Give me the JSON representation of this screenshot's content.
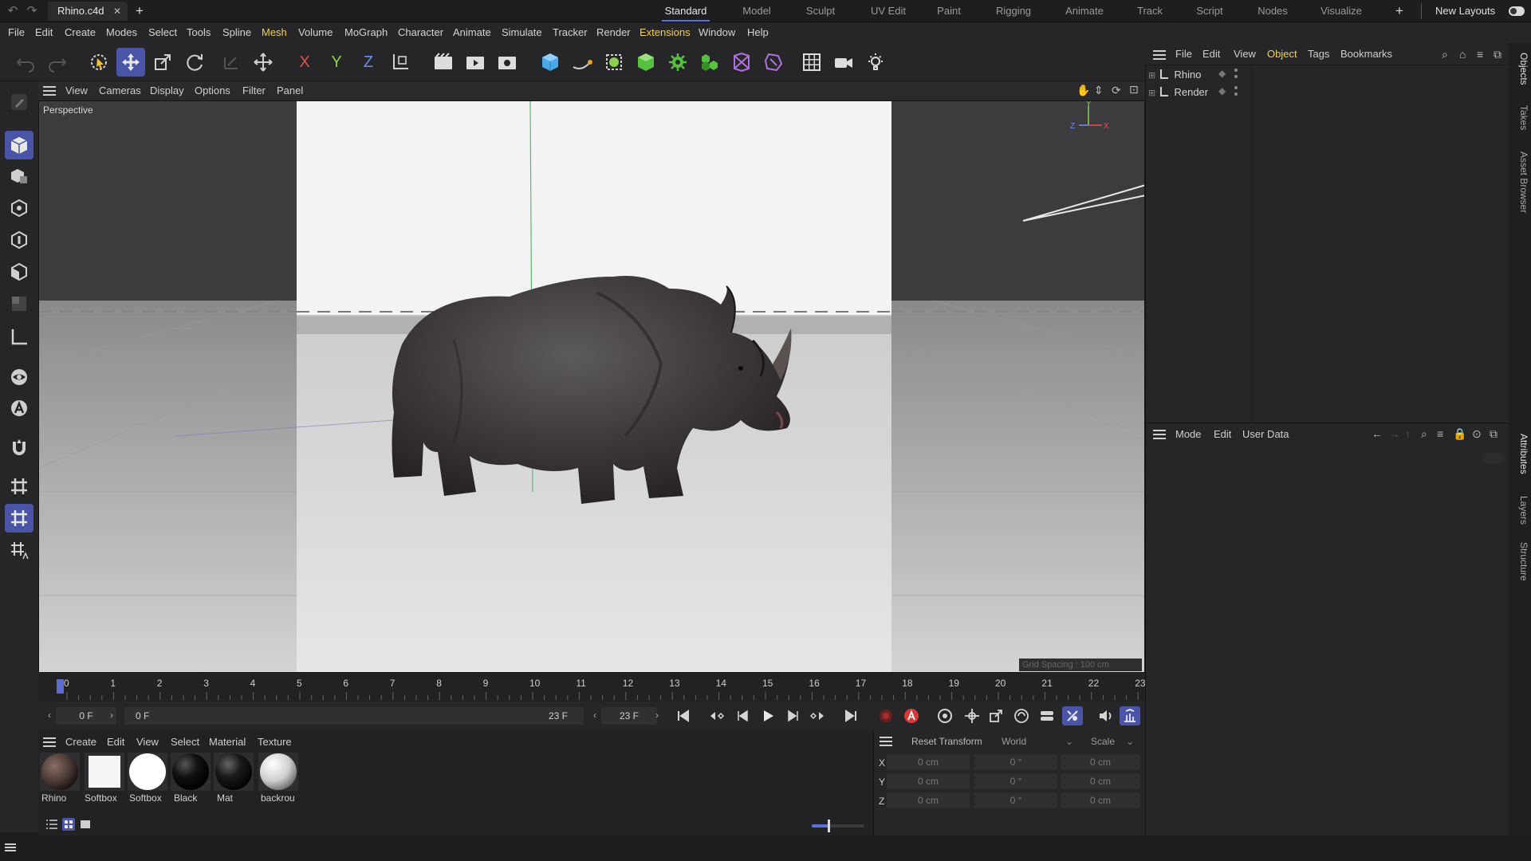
{
  "titlebar": {
    "file_tab": "Rhino.c4d",
    "layouts": [
      "Standard",
      "Model",
      "Sculpt",
      "UV Edit",
      "Paint",
      "Rigging",
      "Animate",
      "Track",
      "Script",
      "Nodes",
      "Visualize"
    ],
    "active_layout": "Standard",
    "new_layouts": "New Layouts"
  },
  "menubar": {
    "items": [
      "File",
      "Edit",
      "Create",
      "Modes",
      "Select",
      "Tools",
      "Spline",
      "Mesh",
      "Volume",
      "MoGraph",
      "Character",
      "Animate",
      "Simulate",
      "Tracker",
      "Render",
      "Extensions",
      "Window",
      "Help"
    ],
    "highlighted": [
      "Mesh",
      "Extensions"
    ]
  },
  "toolbar": {
    "axis_x": "X",
    "axis_y": "Y",
    "axis_z": "Z"
  },
  "viewport": {
    "menu": [
      "View",
      "Cameras",
      "Display",
      "Options",
      "Filter",
      "Panel"
    ],
    "label": "Perspective",
    "grid_spacing": "Grid Spacing : 100 cm",
    "axis_labels": {
      "y": "Y",
      "z": "Z",
      "x": "X"
    }
  },
  "timeline": {
    "ticks": [
      "0",
      "1",
      "2",
      "3",
      "4",
      "5",
      "6",
      "7",
      "8",
      "9",
      "10",
      "11",
      "12",
      "13",
      "14",
      "15",
      "16",
      "17",
      "18",
      "19",
      "20",
      "21",
      "22",
      "23"
    ],
    "current_frame": "0 F",
    "range_start": "0 F",
    "range_end": "23 F",
    "end_frame": "23 F"
  },
  "materials": {
    "menu": [
      "Create",
      "Edit",
      "View",
      "Select",
      "Material",
      "Texture"
    ],
    "items": [
      {
        "label": "Rhino",
        "color": "#4a3a36"
      },
      {
        "label": "Softbox",
        "color": "#f4f4f4"
      },
      {
        "label": "Softbox",
        "color": "#ffffff"
      },
      {
        "label": "Black",
        "color": "#0a0a0a"
      },
      {
        "label": "Mat",
        "color": "#141414"
      },
      {
        "label": "backrou",
        "color": "#e8e8e8"
      }
    ]
  },
  "coordinates": {
    "reset_transform": "Reset Transform",
    "space": "World",
    "mode": "Scale",
    "rows": [
      {
        "axis": "X",
        "pos": "0 cm",
        "rot": "0 °",
        "scale": "0 cm"
      },
      {
        "axis": "Y",
        "pos": "0 cm",
        "rot": "0 °",
        "scale": "0 cm"
      },
      {
        "axis": "Z",
        "pos": "0 cm",
        "rot": "0 °",
        "scale": "0 cm"
      }
    ]
  },
  "objects": {
    "menu": [
      "File",
      "Edit",
      "View",
      "Object",
      "Tags",
      "Bookmarks"
    ],
    "highlighted": "Object",
    "items": [
      "Rhino",
      "Render"
    ]
  },
  "attributes": {
    "menu": [
      "Mode",
      "Edit",
      "User Data"
    ]
  },
  "side_tabs": [
    "Objects",
    "Takes",
    "Asset Browser",
    "Attributes",
    "Layers",
    "Structure"
  ],
  "colors": {
    "accent": "#5b72d8",
    "highlight_menu": "#f0d060",
    "panel_bg": "#262628"
  }
}
